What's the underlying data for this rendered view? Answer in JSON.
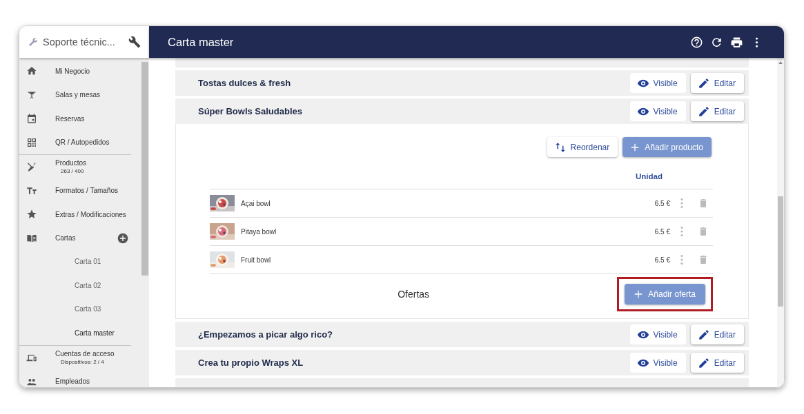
{
  "sidebar": {
    "search": {
      "value": "Soporte técnic..."
    },
    "items": [
      {
        "label": "Mi Negocio"
      },
      {
        "label": "Salas y mesas"
      },
      {
        "label": "Reservas"
      },
      {
        "label": "QR / Autopedidos",
        "divider_after": true
      },
      {
        "label": "Productos",
        "sub": "263 / 400"
      },
      {
        "label": "Formatos / Tamaños"
      },
      {
        "label": "Extras / Modificaciones"
      },
      {
        "label": "Cartas",
        "add": true,
        "children": [
          {
            "label": "Carta 01",
            "selected": false
          },
          {
            "label": "Carta 02",
            "selected": false
          },
          {
            "label": "Carta 03",
            "selected": false
          },
          {
            "label": "Carta master",
            "selected": true
          }
        ],
        "divider_after": true
      },
      {
        "label": "Cuentas de acceso",
        "sub": "Dispositivos: 2 / 4"
      },
      {
        "label": "Empleados"
      }
    ]
  },
  "header": {
    "title": "Carta master"
  },
  "categories": [
    {
      "title": "Tostas dulces & fresh",
      "expanded": false,
      "visible_label": "Visible",
      "edit_label": "Editar"
    },
    {
      "title": "Súper Bowls Saludables",
      "expanded": true,
      "visible_label": "Visible",
      "edit_label": "Editar",
      "actions": {
        "reorder": "Reordenar",
        "add_product": "Añadir producto"
      },
      "price_header": "Unidad",
      "products": [
        {
          "name": "Açai bowl",
          "price": "6.5 €"
        },
        {
          "name": "Pitaya bowl",
          "price": "6.5 €"
        },
        {
          "name": "Fruit bowl",
          "price": "6.5 €"
        }
      ],
      "offers": {
        "label": "Ofertas",
        "button": "Añadir oferta",
        "highlighted": true
      }
    },
    {
      "title": "¿Empezamos a picar algo rico?",
      "expanded": false,
      "visible_label": "Visible",
      "edit_label": "Editar"
    },
    {
      "title": "Crea tu propio Wraps XL",
      "expanded": false,
      "visible_label": "Visible",
      "edit_label": "Editar"
    }
  ]
}
